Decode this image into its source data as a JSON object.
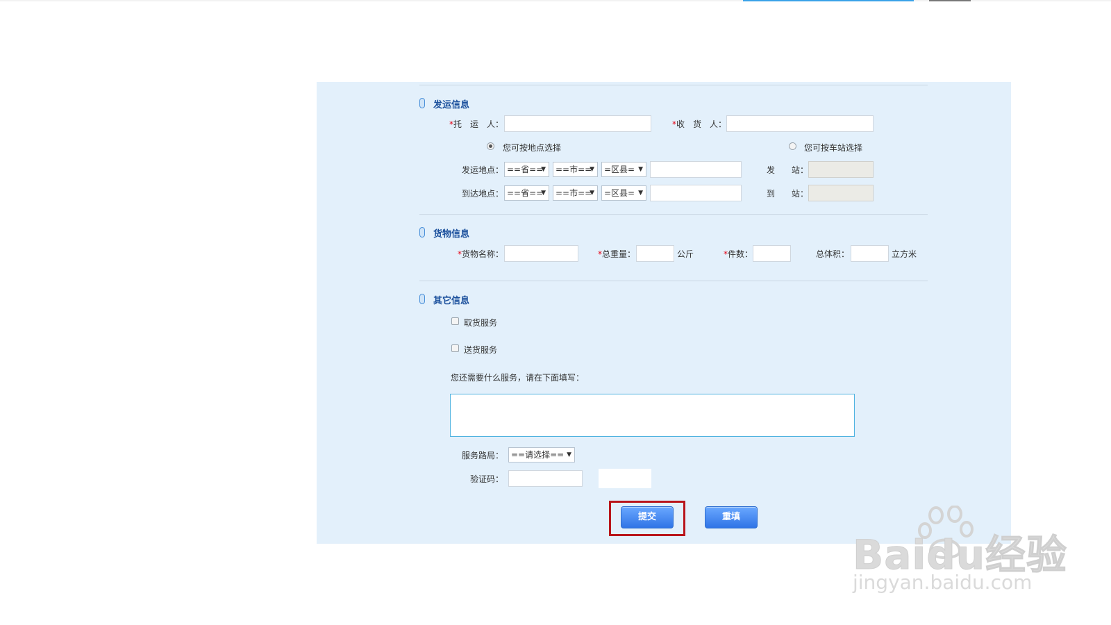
{
  "sections": {
    "shipping": {
      "title": "发运信息"
    },
    "cargo": {
      "title": "货物信息"
    },
    "other": {
      "title": "其它信息"
    }
  },
  "shipping": {
    "shipper_label": "托　运　人：",
    "receiver_label": "收　货　人：",
    "required_mark": "*",
    "radio_by_location": "您可按地点选择",
    "radio_by_station": "您可按车站选择",
    "from_label": "发运地点：",
    "to_label": "到达地点：",
    "province_select": "==省==",
    "city_select": "==市==",
    "county_select": "=区县=",
    "from_station_label": "发　　站：",
    "to_station_label": "到　　站：",
    "selected_radio": "by_location"
  },
  "cargo": {
    "name_label": "货物名称：",
    "weight_label": "总重量：",
    "weight_unit": "公斤",
    "count_label": "件数：",
    "volume_label": "总体积：",
    "volume_unit": "立方米"
  },
  "other": {
    "pickup_label": "取货服务",
    "delivery_label": "送货服务",
    "extra_prompt": "您还需要什么服务，请在下面填写：",
    "bureau_label": "服务路局：",
    "bureau_select": "==请选择==",
    "captcha_label": "验证码："
  },
  "buttons": {
    "submit": "提交",
    "reset": "重填"
  },
  "watermark": {
    "main": "Baidu经验",
    "sub": "jingyan.baidu.com"
  },
  "colors": {
    "panel_bg": "#e3f0fb",
    "section_title": "#1a4f9c",
    "button": "#2f74e6",
    "highlight": "#b9151b",
    "required": "#e60012"
  }
}
